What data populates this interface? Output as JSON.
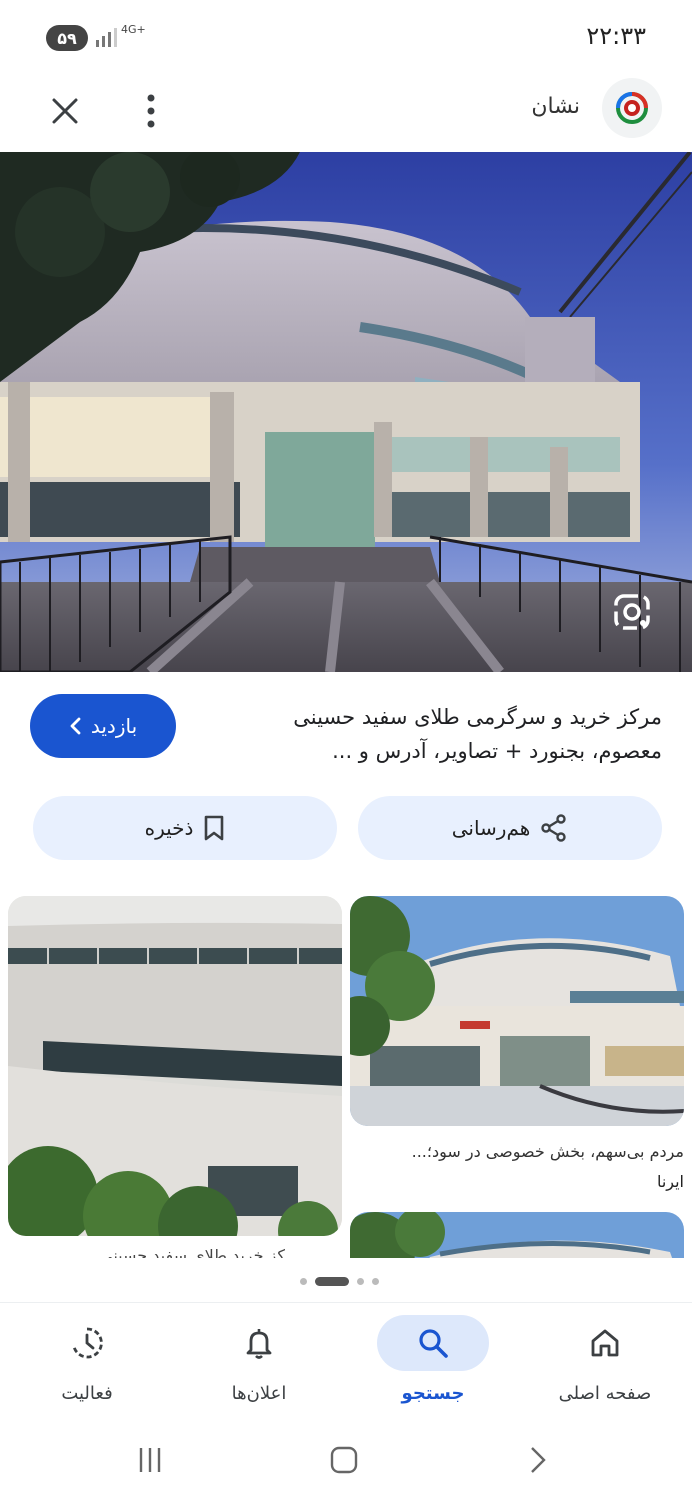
{
  "status": {
    "time": "۲۲:۳۳",
    "battery": "۵۹",
    "network": "4G+"
  },
  "header": {
    "site_name": "نشان",
    "close_icon": "close-icon",
    "menu_icon": "more-vert-icon"
  },
  "result": {
    "title_line1": "مرکز خرید و سرگرمی طلای سفید حسینی",
    "title_line2": "معصوم، بجنورد + تصاویر، آدرس و ...",
    "visit_label": "بازدید"
  },
  "actions": {
    "share_label": "هم‌رسانی",
    "save_label": "ذخیره"
  },
  "related": {
    "right_caption": "مردم بی‌سهم، بخش خصوصی در سود؛...",
    "right_source": "ایرنا",
    "left_caption": "کز خرید طلای سفید حسینی"
  },
  "bottom_nav": [
    {
      "label": "صفحه اصلی",
      "icon": "home-icon"
    },
    {
      "label": "جستجو",
      "icon": "search-icon"
    },
    {
      "label": "اعلان‌ها",
      "icon": "bell-icon"
    },
    {
      "label": "فعالیت",
      "icon": "activity-icon"
    }
  ],
  "colors": {
    "accent": "#1a55d0",
    "chip_bg": "#e8f0fe",
    "active_nav_bg": "#dde8fb"
  }
}
